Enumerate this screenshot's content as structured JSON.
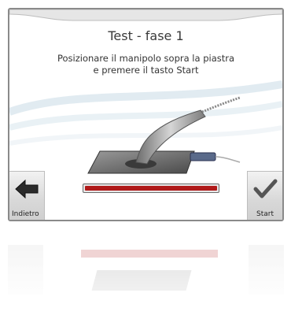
{
  "screen": {
    "title": "Test - fase 1",
    "instruction_line1": "Posizionare il manipolo sopra la piastra",
    "instruction_line2": "e premere il tasto Start"
  },
  "buttons": {
    "back_label": "Indietro",
    "start_label": "Start"
  },
  "icons": {
    "back": "arrow-left-icon",
    "start": "checkmark-icon"
  },
  "progress": {
    "value_fraction": 1.0,
    "color": "#b01a1a"
  },
  "colors": {
    "frame": "#8a8a8a",
    "button_bg": "#d8d8d8",
    "text": "#3a3a3a"
  }
}
